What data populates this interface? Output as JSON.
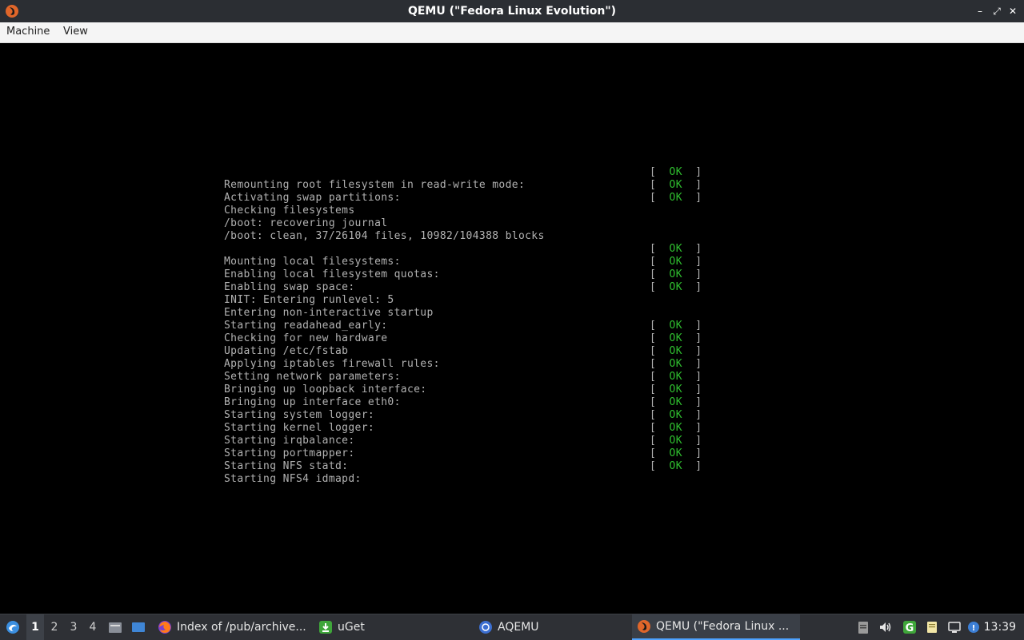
{
  "window": {
    "title": "QEMU (\"Fedora Linux Evolution\")"
  },
  "menubar": {
    "items": [
      "Machine",
      "View"
    ]
  },
  "console": {
    "lines": [
      {
        "text": "",
        "status": "OK"
      },
      {
        "text": "Remounting root filesystem in read-write mode:",
        "status": "OK"
      },
      {
        "text": "Activating swap partitions:",
        "status": "OK"
      },
      {
        "text": "Checking filesystems",
        "status": ""
      },
      {
        "text": "/boot: recovering journal",
        "status": ""
      },
      {
        "text": "/boot: clean, 37/26104 files, 10982/104388 blocks",
        "status": ""
      },
      {
        "text": "",
        "status": "OK"
      },
      {
        "text": "Mounting local filesystems:",
        "status": "OK"
      },
      {
        "text": "Enabling local filesystem quotas:",
        "status": "OK"
      },
      {
        "text": "Enabling swap space:",
        "status": "OK"
      },
      {
        "text": "INIT: Entering runlevel: 5",
        "status": ""
      },
      {
        "text": "Entering non-interactive startup",
        "status": ""
      },
      {
        "text": "Starting readahead_early:",
        "status": "OK"
      },
      {
        "text": "Checking for new hardware",
        "status": "OK"
      },
      {
        "text": "Updating /etc/fstab",
        "status": "OK"
      },
      {
        "text": "Applying iptables firewall rules:",
        "status": "OK"
      },
      {
        "text": "Setting network parameters:",
        "status": "OK"
      },
      {
        "text": "Bringing up loopback interface:",
        "status": "OK"
      },
      {
        "text": "Bringing up interface eth0:",
        "status": "OK"
      },
      {
        "text": "Starting system logger:",
        "status": "OK"
      },
      {
        "text": "Starting kernel logger:",
        "status": "OK"
      },
      {
        "text": "Starting irqbalance:",
        "status": "OK"
      },
      {
        "text": "Starting portmapper:",
        "status": "OK"
      },
      {
        "text": "Starting NFS statd:",
        "status": "OK"
      },
      {
        "text": "Starting NFS4 idmapd:",
        "status": ""
      }
    ]
  },
  "taskbar": {
    "workspaces": [
      "1",
      "2",
      "3",
      "4"
    ],
    "active_workspace": "1",
    "tasks": [
      {
        "label": "Index of /pub/archive...",
        "icon": "firefox-icon"
      },
      {
        "label": "uGet",
        "icon": "uget-icon"
      },
      {
        "label": "AQEMU",
        "icon": "aqemu-icon"
      },
      {
        "label": "QEMU (\"Fedora Linux ...",
        "icon": "qemu-icon",
        "active": true
      }
    ],
    "clock": "13:39"
  },
  "colors": {
    "ok_green": "#2fbf2f",
    "console_text": "#b2b2b2",
    "titlebar": "#2b2e33",
    "taskbar": "#2e3035"
  }
}
